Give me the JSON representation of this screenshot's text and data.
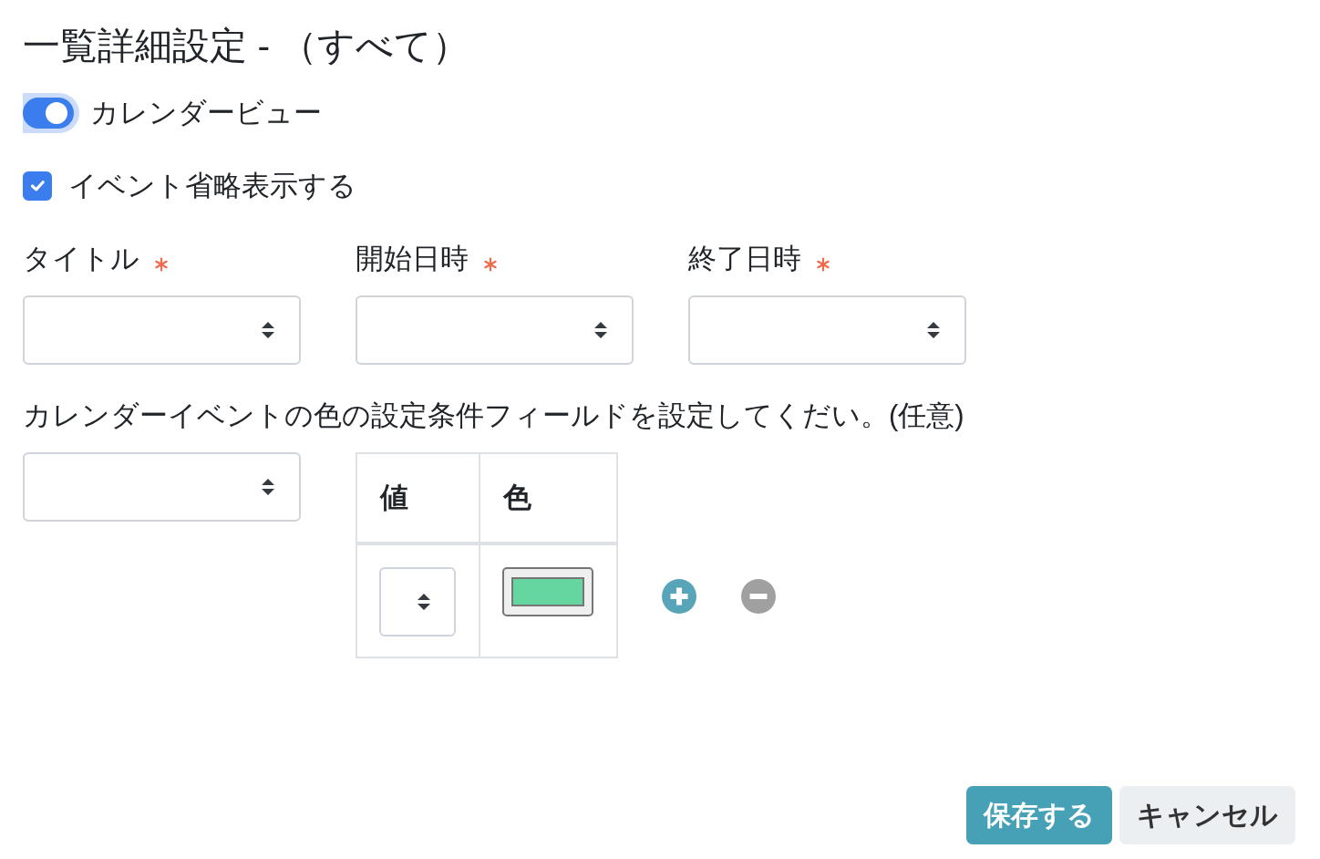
{
  "title": "一覧詳細設定 - （すべて）",
  "calendar_view": {
    "label": "カレンダービュー",
    "on": true,
    "focused": true
  },
  "abbreviate_events": {
    "label": "イベント省略表示する",
    "checked": true
  },
  "fields": [
    {
      "label": "タイトル",
      "required": true,
      "kind": "select"
    },
    {
      "label": "開始日時",
      "required": true,
      "kind": "select"
    },
    {
      "label": "終了日時",
      "required": true,
      "kind": "select"
    }
  ],
  "color_settings": {
    "description": "カレンダーイベントの色の設定条件フィールドを設定してくだい。(任意)",
    "condition_field": {
      "kind": "select"
    },
    "table": {
      "columns": [
        "値",
        "色"
      ],
      "rows": [
        {
          "value_field": {
            "kind": "select"
          },
          "color": "#66d6a0"
        }
      ]
    },
    "row_actions": [
      {
        "kind": "add"
      },
      {
        "kind": "remove"
      }
    ]
  },
  "buttons": [
    {
      "label": "保存する",
      "kind": "primary"
    },
    {
      "label": "キャンセル",
      "kind": "secondary"
    }
  ]
}
